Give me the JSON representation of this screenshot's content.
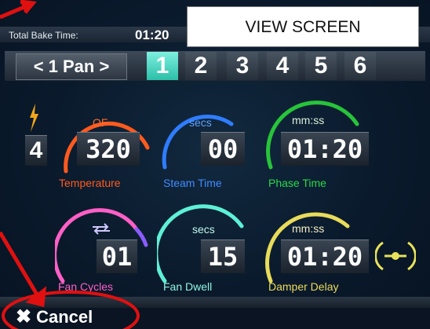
{
  "header": {
    "total_bake_label": "Total Bake Time:",
    "total_bake_value": "01:20",
    "view_screen": "VIEW SCREEN"
  },
  "pan_nav": {
    "pan_label": "< 1 Pan >",
    "tabs": [
      "1",
      "2",
      "3",
      "4",
      "5",
      "6"
    ],
    "active_tab": "1"
  },
  "left_level": {
    "value": "4",
    "icon": "lightning-icon"
  },
  "dials": {
    "temperature": {
      "unit": "OF",
      "value": "320",
      "label": "Temperature",
      "color": "#ff5a1e"
    },
    "steam_time": {
      "unit": "secs",
      "value": "00",
      "label": "Steam Time",
      "color": "#2f7dff"
    },
    "phase_time": {
      "unit": "mm:ss",
      "value": "01:20",
      "label": "Phase Time",
      "color": "#27c43a"
    },
    "fan_cycles": {
      "unit_icon": "cycle-icon",
      "value": "01",
      "label": "Fan Cycles",
      "color": "#ff5fc6"
    },
    "fan_dwell": {
      "unit": "secs",
      "value": "15",
      "label": "Fan Dwell",
      "color": "#5ef0d6"
    },
    "damper_delay": {
      "unit": "mm:ss",
      "value": "01:20",
      "label": "Damper Delay",
      "color": "#e8dc5a"
    }
  },
  "footer": {
    "cancel_label": "Cancel"
  },
  "colors": {
    "annotation_red": "#e01010",
    "active_tab": "#35d0b8"
  }
}
